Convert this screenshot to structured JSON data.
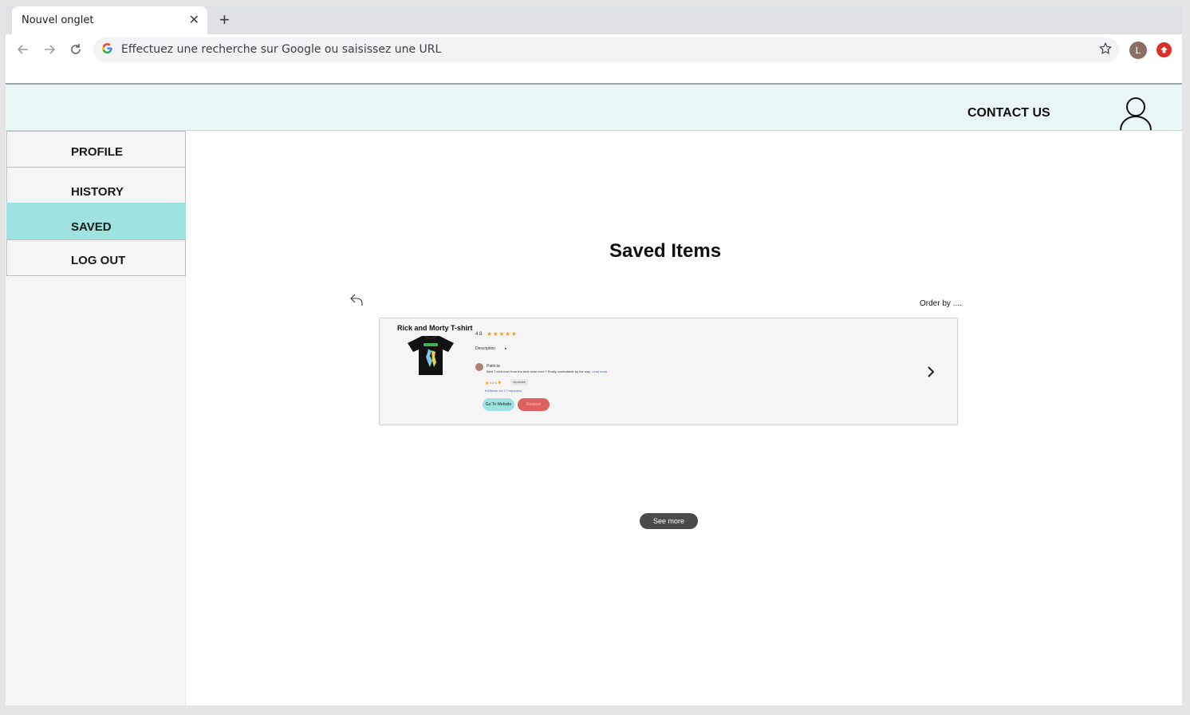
{
  "browser": {
    "tab_title": "Nouvel onglet",
    "tab_close": "✕",
    "new_tab": "+",
    "omnibox_placeholder": "Effectuez une recherche sur Google ou saisissez une URL",
    "profile_initial": "L",
    "profile_color": "#8d6e63",
    "update_badge_color": "#d93025"
  },
  "header": {
    "contact_label": "CONTACT US",
    "background_color": "#e9f8f7"
  },
  "sidebar": {
    "items": [
      {
        "label": "PROFILE",
        "active": false
      },
      {
        "label": "HISTORY",
        "active": false
      },
      {
        "label": "SAVED",
        "active": true
      },
      {
        "label": "LOG OUT",
        "active": false
      }
    ],
    "active_color": "#9ee3df"
  },
  "main": {
    "title": "Saved Items",
    "order_by": "Order by ....",
    "see_more": "See more"
  },
  "saved_items": [
    {
      "title": "Rick and Morty T-shirt",
      "rating": "4.8",
      "stars": "★★★★★",
      "description_label": "Description",
      "description_caret": "▸",
      "review": {
        "author": "Patricia",
        "text": "Best T-shirt ever from the best serie ever !! Really comfortable by the way...",
        "read_more": "read more",
        "likes": "👍 6.2 k   👎",
        "reply_label": "répondre",
        "show_replies": "▾  Afficher les 17 réponses"
      },
      "go_button": "Go To Website",
      "remove_button": "Remove"
    }
  ]
}
